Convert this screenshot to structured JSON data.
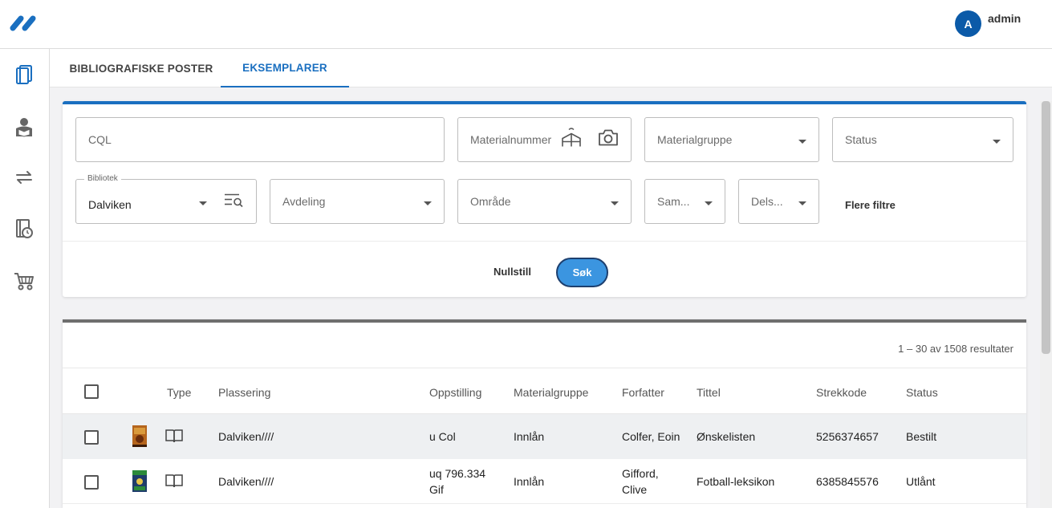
{
  "app": {
    "accent_color": "#1a6fc0",
    "logo_icon": "brand-logo-icon"
  },
  "user": {
    "initial": "A",
    "name": "admin"
  },
  "sidenav": [
    {
      "icon": "books-icon"
    },
    {
      "icon": "reader-icon"
    },
    {
      "icon": "transfer-arrows-icon"
    },
    {
      "icon": "overdue-book-icon"
    },
    {
      "icon": "cart-icon"
    }
  ],
  "tabs": [
    {
      "label": "BIBLIOGRAFISKE POSTER",
      "active": false
    },
    {
      "label": "EKSEMPLARER",
      "active": true
    }
  ],
  "filters": {
    "cql_placeholder": "CQL",
    "materialnummer_placeholder": "Materialnummer",
    "materialgruppe_placeholder": "Materialgruppe",
    "status_placeholder": "Status",
    "bibliotek_label": "Bibliotek",
    "bibliotek_value": "Dalviken",
    "avdeling_placeholder": "Avdeling",
    "omrade_placeholder": "Område",
    "samling_placeholder": "Sam...",
    "delsamling_placeholder": "Dels...",
    "more_filters": "Flere filtre",
    "reset": "Nullstill",
    "search": "Søk"
  },
  "results": {
    "count_text": "1 – 30 av 1508 resultater",
    "columns": {
      "type": "Type",
      "plassering": "Plassering",
      "oppstilling": "Oppstilling",
      "materialgruppe": "Materialgruppe",
      "forfatter": "Forfatter",
      "tittel": "Tittel",
      "strekkode": "Strekkode",
      "status": "Status"
    },
    "rows": [
      {
        "plassering": "Dalviken////",
        "oppstilling": "u Col",
        "materialgruppe": "Innlån",
        "forfatter": "Colfer, Eoin",
        "tittel": "Ønskelisten",
        "strekkode": "5256374657",
        "status": "Bestilt",
        "type_icon": "book-icon"
      },
      {
        "plassering": "Dalviken////",
        "oppstilling_line1": "uq 796.334",
        "oppstilling_line2": "Gif",
        "materialgruppe": "Innlån",
        "forfatter_line1": "Gifford,",
        "forfatter_line2": "Clive",
        "tittel": "Fotball-leksikon",
        "strekkode": "6385845576",
        "status": "Utlånt",
        "type_icon": "book-icon"
      }
    ]
  }
}
